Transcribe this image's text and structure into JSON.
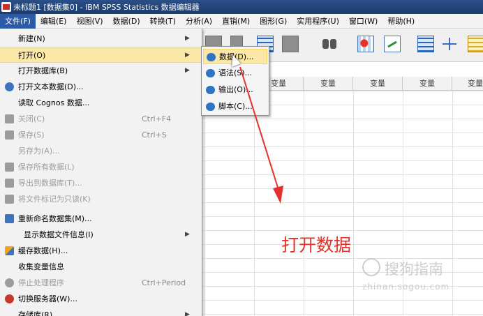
{
  "window": {
    "title": "未标题1 [数据集0] - IBM SPSS Statistics 数据编辑器"
  },
  "menubar": [
    "文件(F)",
    "编辑(E)",
    "视图(V)",
    "数据(D)",
    "转换(T)",
    "分析(A)",
    "直销(M)",
    "图形(G)",
    "实用程序(U)",
    "窗口(W)",
    "帮助(H)"
  ],
  "file_menu": {
    "items": [
      {
        "label": "新建(N)",
        "shortcut": "",
        "submenu": true
      },
      {
        "label": "打开(O)",
        "shortcut": "",
        "submenu": true
      },
      {
        "label": "打开数据库(B)",
        "shortcut": "",
        "submenu": true
      },
      {
        "label": "打开文本数据(D)...",
        "shortcut": ""
      },
      {
        "label": "读取 Cognos 数据...",
        "shortcut": ""
      },
      {
        "label": "关闭(C)",
        "shortcut": "Ctrl+F4"
      },
      {
        "label": "保存(S)",
        "shortcut": "Ctrl+S"
      },
      {
        "label": "另存为(A)...",
        "shortcut": ""
      },
      {
        "label": "保存所有数据(L)",
        "shortcut": ""
      },
      {
        "label": "导出到数据库(T)...",
        "shortcut": ""
      },
      {
        "label": "将文件标记为只读(K)",
        "shortcut": ""
      },
      {
        "label": "重新命名数据集(M)...",
        "shortcut": ""
      },
      {
        "label": "显示数据文件信息(I)",
        "shortcut": "",
        "submenu": true
      },
      {
        "label": "缓存数据(H)...",
        "shortcut": ""
      },
      {
        "label": "收集变量信息",
        "shortcut": ""
      },
      {
        "label": "停止处理程序",
        "shortcut": "Ctrl+Period"
      },
      {
        "label": "切换服务器(W)...",
        "shortcut": ""
      },
      {
        "label": "存储库(R)",
        "shortcut": "",
        "submenu": true
      }
    ],
    "arrow_glyph": "▶"
  },
  "open_submenu": {
    "items": [
      "数据(D)...",
      "语法(S)...",
      "输出(O)...",
      "脚本(C)..."
    ]
  },
  "grid": {
    "column_header": "变量",
    "columns": [
      "变量",
      "变量",
      "变量",
      "变量",
      "变量",
      "变量"
    ]
  },
  "annotation": {
    "text": "打开数据",
    "color": "#e0322e"
  },
  "watermark": {
    "main": "搜狗指南",
    "sub": "zhinan.sogou.com"
  },
  "colors": {
    "menu_highlight": "#fce8a6",
    "title_bar": "#2a4f86",
    "menu_active": "#2d5aa6"
  }
}
